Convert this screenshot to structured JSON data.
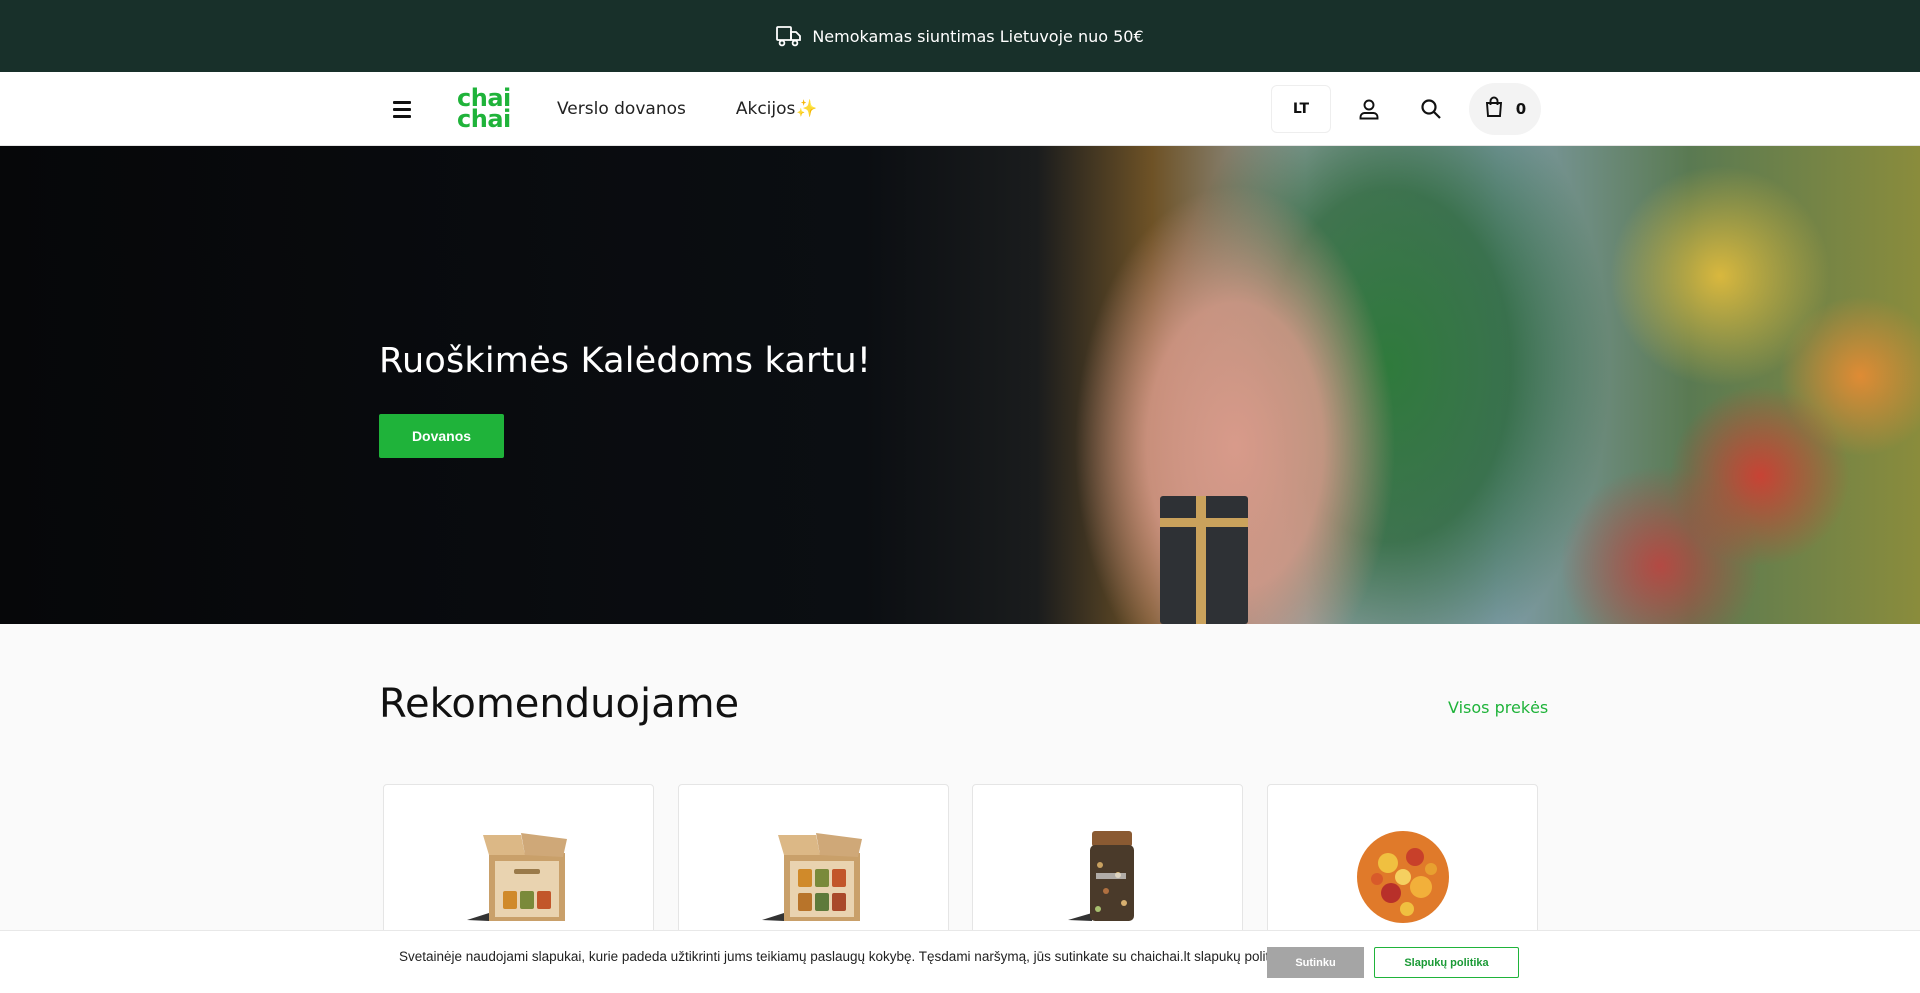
{
  "announcement": {
    "icon": "delivery-truck-icon",
    "text": "Nemokamas siuntimas Lietuvoje nuo 50€"
  },
  "header": {
    "logo_line1": "chai",
    "logo_line2": "chai",
    "nav": [
      {
        "label": "Verslo dovanos"
      },
      {
        "label": "Akcijos",
        "suffix": "✨"
      }
    ],
    "language": "LT",
    "cart_count": "0",
    "brand_color": "#1fb33a"
  },
  "hero": {
    "title": "Ruoškimės Kalėdoms kartu!",
    "button_label": "Dovanos"
  },
  "recommended": {
    "title": "Rekomenduojame",
    "see_all": "Visos prekės",
    "products": [
      {
        "image": "gift-box-3-jars"
      },
      {
        "image": "gift-box-6-jars"
      },
      {
        "image": "tea-jar"
      },
      {
        "image": "loose-tea-blend"
      }
    ]
  },
  "cookie": {
    "text": "Svetainėje naudojami slapukai, kurie padeda užtikrinti jums teikiamų paslaugų kokybę. Tęsdami naršymą, jūs sutinkate su chaichai.lt slapukų politika.",
    "accept_label": "Sutinku",
    "policy_label": "Slapukų politika"
  },
  "colors": {
    "topbar_bg": "#18302a",
    "accent": "#1fb33a"
  }
}
